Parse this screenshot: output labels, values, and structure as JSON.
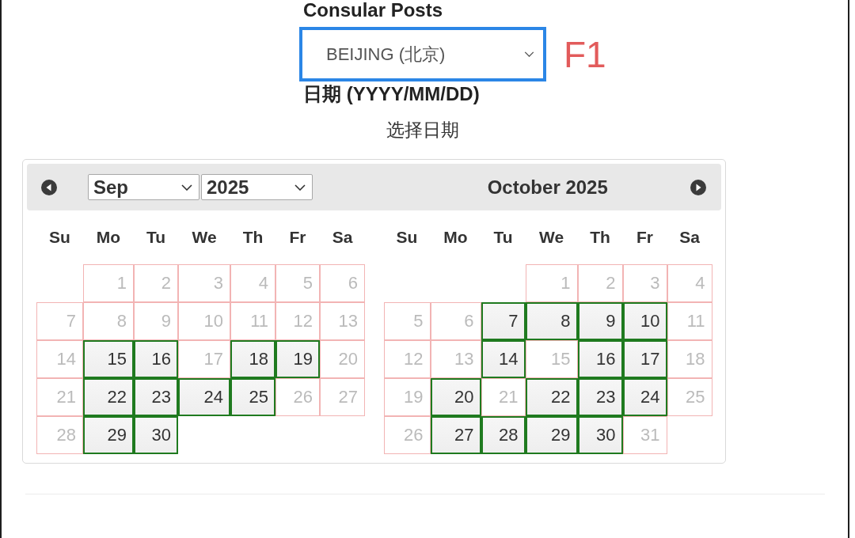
{
  "form": {
    "post_label": "Consular Posts",
    "post_select": {
      "value": "BEIJING (北京)",
      "highlighted": true
    },
    "annotation": "F1",
    "date_label": "日期 (YYYY/MM/DD)",
    "date_prompt": "选择日期"
  },
  "calendar": {
    "months": [
      {
        "kind": "dropdowns",
        "month_select": "Sep",
        "year_select": "2025",
        "weekdays": [
          "Su",
          "Mo",
          "Tu",
          "We",
          "Th",
          "Fr",
          "Sa"
        ],
        "weeks": [
          {
            "right_aligned": true,
            "days": [
              {
                "day": "1",
                "available": false
              },
              {
                "day": "2",
                "available": false
              },
              {
                "day": "3",
                "available": false
              },
              {
                "day": "4",
                "available": false
              },
              {
                "day": "5",
                "available": false
              },
              {
                "day": "6",
                "available": false
              }
            ]
          },
          {
            "days": [
              {
                "day": "7",
                "available": false
              },
              {
                "day": "8",
                "available": false
              },
              {
                "day": "9",
                "available": false
              },
              {
                "day": "10",
                "available": false
              },
              {
                "day": "11",
                "available": false
              },
              {
                "day": "12",
                "available": false
              },
              {
                "day": "13",
                "available": false
              }
            ]
          },
          {
            "days": [
              {
                "day": "14",
                "available": false
              },
              {
                "day": "15",
                "available": true
              },
              {
                "day": "16",
                "available": true
              },
              {
                "day": "17",
                "available": false
              },
              {
                "day": "18",
                "available": true
              },
              {
                "day": "19",
                "available": true
              },
              {
                "day": "20",
                "available": false
              }
            ]
          },
          {
            "days": [
              {
                "day": "21",
                "available": false
              },
              {
                "day": "22",
                "available": true
              },
              {
                "day": "23",
                "available": true
              },
              {
                "day": "24",
                "available": true
              },
              {
                "day": "25",
                "available": true
              },
              {
                "day": "26",
                "available": false
              },
              {
                "day": "27",
                "available": false
              }
            ]
          },
          {
            "right_aligned": false,
            "days": [
              {
                "day": "28",
                "available": false
              },
              {
                "day": "29",
                "available": true
              },
              {
                "day": "30",
                "available": true
              }
            ]
          }
        ]
      },
      {
        "kind": "title",
        "title": "October 2025",
        "weekdays": [
          "Su",
          "Mo",
          "Tu",
          "We",
          "Th",
          "Fr",
          "Sa"
        ],
        "weeks": [
          {
            "right_aligned": true,
            "days": [
              {
                "day": "1",
                "available": false
              },
              {
                "day": "2",
                "available": false
              },
              {
                "day": "3",
                "available": false
              },
              {
                "day": "4",
                "available": false
              }
            ]
          },
          {
            "days": [
              {
                "day": "5",
                "available": false
              },
              {
                "day": "6",
                "available": false
              },
              {
                "day": "7",
                "available": true
              },
              {
                "day": "8",
                "available": true
              },
              {
                "day": "9",
                "available": true
              },
              {
                "day": "10",
                "available": true
              },
              {
                "day": "11",
                "available": false
              }
            ]
          },
          {
            "days": [
              {
                "day": "12",
                "available": false
              },
              {
                "day": "13",
                "available": false
              },
              {
                "day": "14",
                "available": true
              },
              {
                "day": "15",
                "available": false
              },
              {
                "day": "16",
                "available": true
              },
              {
                "day": "17",
                "available": true
              },
              {
                "day": "18",
                "available": false
              }
            ]
          },
          {
            "days": [
              {
                "day": "19",
                "available": false
              },
              {
                "day": "20",
                "available": true
              },
              {
                "day": "21",
                "available": false
              },
              {
                "day": "22",
                "available": true
              },
              {
                "day": "23",
                "available": true
              },
              {
                "day": "24",
                "available": true
              },
              {
                "day": "25",
                "available": false
              }
            ]
          },
          {
            "right_aligned": false,
            "days": [
              {
                "day": "26",
                "available": false
              },
              {
                "day": "27",
                "available": true
              },
              {
                "day": "28",
                "available": true
              },
              {
                "day": "29",
                "available": true
              },
              {
                "day": "30",
                "available": true
              },
              {
                "day": "31",
                "available": false
              }
            ]
          }
        ]
      }
    ]
  }
}
